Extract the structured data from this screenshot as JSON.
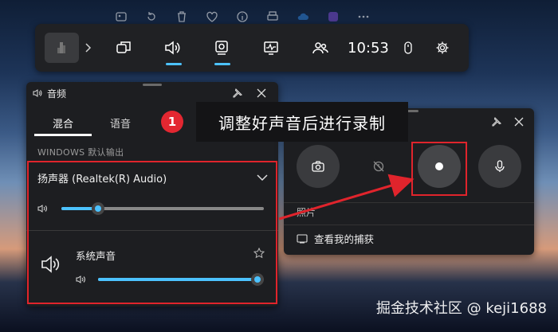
{
  "game_bar": {
    "time": "10:53",
    "widgets": [
      "widget-menu",
      "audio",
      "capture",
      "performance",
      "social"
    ]
  },
  "audio_panel": {
    "title": "音频",
    "tabs": [
      {
        "label": "混合",
        "active": true
      },
      {
        "label": "语音",
        "active": false
      }
    ],
    "section_label": "WINDOWS 默认输出",
    "device": {
      "name": "扬声器 (Realtek(R) Audio)",
      "volume": 0.18
    },
    "apps": [
      {
        "name": "系统声音",
        "volume": 0.96
      }
    ]
  },
  "capture_panel": {
    "photos_label": "照片",
    "view_captures_label": "查看我的捕获"
  },
  "callout": {
    "step": "1",
    "text": "调整好声音后进行录制"
  },
  "watermark": "掘金技术社区 @ keji1688",
  "colors": {
    "accent": "#4cc2ff",
    "annotation_red": "#e0242c",
    "panel_bg": "#1d1e21"
  }
}
